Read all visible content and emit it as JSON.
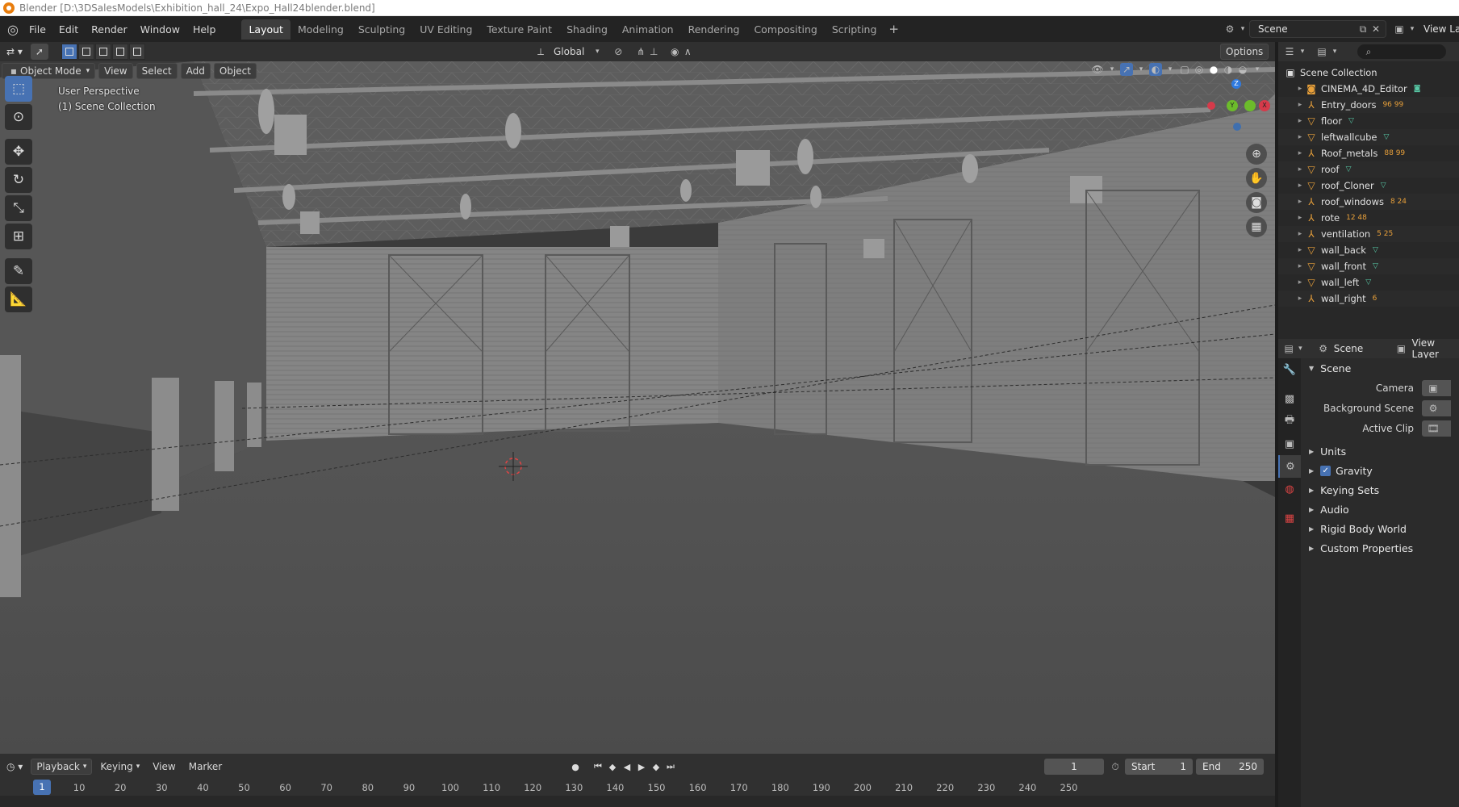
{
  "window": {
    "title": "Blender [D:\\3DSalesModels\\Exhibition_hall_24\\Expo_Hall24blender.blend]"
  },
  "menu": [
    "File",
    "Edit",
    "Render",
    "Window",
    "Help"
  ],
  "workspaces": [
    "Layout",
    "Modeling",
    "Sculpting",
    "UV Editing",
    "Texture Paint",
    "Shading",
    "Animation",
    "Rendering",
    "Compositing",
    "Scripting"
  ],
  "workspace_add": "+",
  "topbar_right": {
    "scene": "Scene",
    "view_layer": "View Layer"
  },
  "viewport_header": {
    "mode": "Object Mode",
    "menus": [
      "View",
      "Select",
      "Add",
      "Object"
    ],
    "orientation": "Global",
    "options": "Options"
  },
  "viewport": {
    "perspective_label": "User Perspective",
    "collection_label": "(1) Scene Collection",
    "gizmo": {
      "x": "X",
      "y": "Y",
      "z": "Z"
    }
  },
  "outliner": {
    "root": "Scene Collection",
    "items": [
      {
        "name": "CINEMA_4D_Editor",
        "type": "camera",
        "extra": ""
      },
      {
        "name": "Entry_doors",
        "type": "empty",
        "extra": "96 99"
      },
      {
        "name": "floor",
        "type": "mesh",
        "extra": ""
      },
      {
        "name": "leftwallcube",
        "type": "mesh",
        "extra": ""
      },
      {
        "name": "Roof_metals",
        "type": "empty",
        "extra": "88 99"
      },
      {
        "name": "roof",
        "type": "mesh",
        "extra": ""
      },
      {
        "name": "roof_Cloner",
        "type": "mesh",
        "extra": ""
      },
      {
        "name": "roof_windows",
        "type": "empty",
        "extra": "8 24"
      },
      {
        "name": "rote",
        "type": "empty",
        "extra": "12 48"
      },
      {
        "name": "ventilation",
        "type": "empty",
        "extra": "5 25"
      },
      {
        "name": "wall_back",
        "type": "mesh",
        "extra": ""
      },
      {
        "name": "wall_front",
        "type": "mesh",
        "extra": ""
      },
      {
        "name": "wall_left",
        "type": "mesh",
        "extra": ""
      },
      {
        "name": "wall_right",
        "type": "empty",
        "extra": "6"
      }
    ]
  },
  "properties": {
    "header_scene": "Scene",
    "header_view_layer": "View Layer",
    "panel_title": "Scene",
    "fields": [
      {
        "label": "Camera"
      },
      {
        "label": "Background Scene"
      },
      {
        "label": "Active Clip"
      }
    ],
    "sections": [
      "Units",
      "Gravity",
      "Keying Sets",
      "Audio",
      "Rigid Body World",
      "Custom Properties"
    ],
    "gravity_checked": true
  },
  "timeline": {
    "menus": [
      "Playback",
      "Keying",
      "View",
      "Marker"
    ],
    "current_frame": "1",
    "start_label": "Start",
    "start": "1",
    "end_label": "End",
    "end": "250",
    "ticks": [
      "10",
      "20",
      "30",
      "40",
      "50",
      "60",
      "70",
      "80",
      "90",
      "100",
      "110",
      "120",
      "130",
      "140",
      "150",
      "160",
      "170",
      "180",
      "190",
      "200",
      "210",
      "220",
      "230",
      "240",
      "250"
    ]
  }
}
